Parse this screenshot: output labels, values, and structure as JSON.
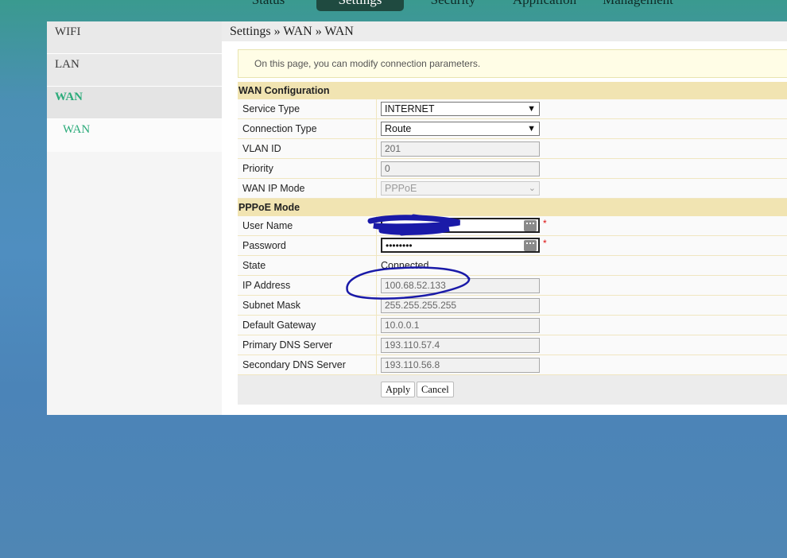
{
  "topnav": {
    "tabs": [
      {
        "label": "Status"
      },
      {
        "label": "Settings"
      },
      {
        "label": "Security"
      },
      {
        "label": "Application"
      },
      {
        "label": "Management"
      }
    ]
  },
  "sidebar": {
    "items": [
      {
        "label": "WIFI"
      },
      {
        "label": "LAN"
      },
      {
        "label": "WAN"
      }
    ],
    "subitems": [
      {
        "label": "WAN"
      }
    ]
  },
  "breadcrumb": "Settings » WAN » WAN",
  "info": "On this page, you can modify connection parameters.",
  "wan_config": {
    "title": "WAN Configuration",
    "service_type": {
      "label": "Service Type",
      "value": "INTERNET"
    },
    "connection_type": {
      "label": "Connection Type",
      "value": "Route"
    },
    "vlan_id": {
      "label": "VLAN ID",
      "value": "201"
    },
    "priority": {
      "label": "Priority",
      "value": "0"
    },
    "wan_ip_mode": {
      "label": "WAN IP Mode",
      "value": "PPPoE"
    }
  },
  "pppoe": {
    "title": "PPPoE Mode",
    "user_name": {
      "label": "User Name",
      "value": ""
    },
    "password": {
      "label": "Password",
      "value": "••••••••"
    },
    "state": {
      "label": "State",
      "value": "Connected"
    },
    "ip_address": {
      "label": "IP Address",
      "value": "100.68.52.133"
    },
    "subnet_mask": {
      "label": "Subnet Mask",
      "value": "255.255.255.255"
    },
    "default_gateway": {
      "label": "Default Gateway",
      "value": "10.0.0.1"
    },
    "primary_dns": {
      "label": "Primary DNS Server",
      "value": "193.110.57.4"
    },
    "secondary_dns": {
      "label": "Secondary DNS Server",
      "value": "193.110.56.8"
    },
    "required_mark": "*"
  },
  "buttons": {
    "apply": "Apply",
    "cancel": "Cancel"
  },
  "icons": {
    "select": "chevron-down-icon",
    "password_manager": "key-icon"
  },
  "colors": {
    "accent": "#2bab7a",
    "nav_active": "#1f4a40",
    "section": "#f1e4b2",
    "scribble": "#1a1aa8"
  }
}
